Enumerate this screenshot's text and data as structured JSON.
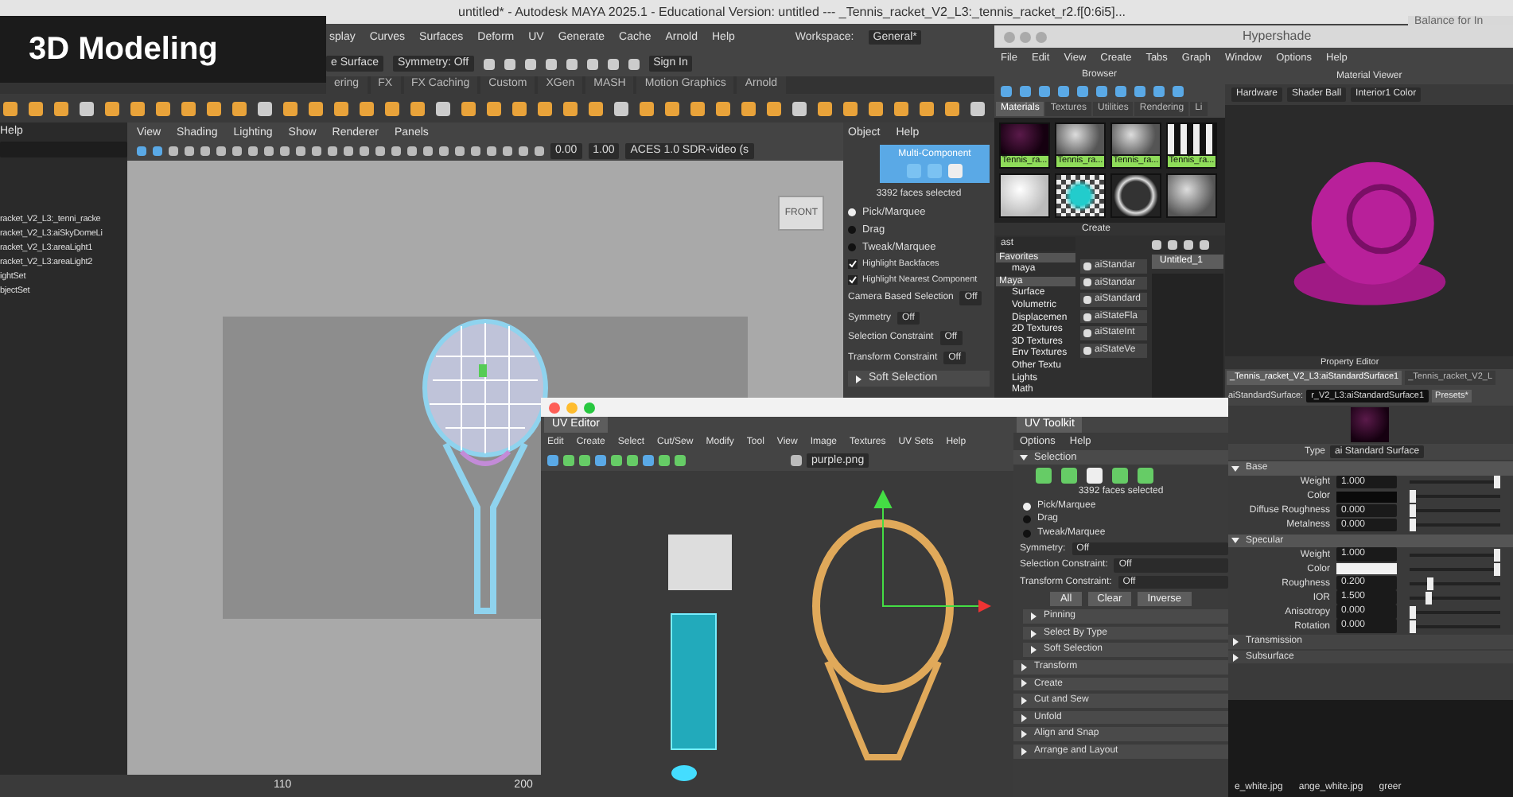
{
  "overlay_title": "3D Modeling",
  "main_window": {
    "title": "untitled* - Autodesk MAYA 2025.1 - Educational Version: untitled  ---  _Tennis_racket_V2_L3:_tennis_racket_r2.f[0:6i5]...",
    "menu": [
      "splay",
      "Curves",
      "Surfaces",
      "Deform",
      "UV",
      "Generate",
      "Cache",
      "Arnold",
      "Help"
    ],
    "workspace_label": "Workspace:",
    "workspace": "General*",
    "status_fields": [
      "e Surface",
      "Symmetry: Off"
    ],
    "sign_in": "Sign In",
    "shelf_tabs": [
      "ering",
      "FX",
      "FX Caching",
      "Custom",
      "XGen",
      "MASH",
      "Motion Graphics",
      "Arnold"
    ],
    "outliner": {
      "menu": "Help",
      "items": [
        "racket_V2_L3:_tenni_racke",
        "racket_V2_L3:aiSkyDomeLi",
        "racket_V2_L3:areaLight1",
        "racket_V2_L3:areaLight2",
        "ightSet",
        "bjectSet"
      ]
    },
    "viewport": {
      "menu": [
        "View",
        "Shading",
        "Lighting",
        "Show",
        "Renderer",
        "Panels"
      ],
      "exposure": "0.00",
      "gamma": "1.00",
      "color_space": "ACES 1.0 SDR-video (s",
      "view_cube": "FRONT"
    },
    "toolkit": {
      "menu": [
        "Object",
        "Help"
      ],
      "mode": "Multi-Component",
      "count": "3392 faces selected",
      "radios": [
        {
          "label": "Pick/Marquee",
          "selected": true
        },
        {
          "label": "Drag",
          "selected": false
        },
        {
          "label": "Tweak/Marquee",
          "selected": false
        }
      ],
      "checks": [
        {
          "label": "Highlight Backfaces",
          "checked": true
        },
        {
          "label": "Highlight Nearest Component",
          "checked": true
        }
      ],
      "options": [
        {
          "label": "Camera Based Selection",
          "value": "Off"
        },
        {
          "label": "Symmetry",
          "value": "Off"
        },
        {
          "label": "Selection Constraint",
          "value": "Off"
        },
        {
          "label": "Transform Constraint",
          "value": "Off"
        }
      ],
      "section": "Soft Selection"
    },
    "timeline": [
      "110",
      "200"
    ]
  },
  "other_window_title": "Balance for In",
  "hypershade": {
    "title": "Hypershade",
    "menu": [
      "File",
      "Edit",
      "View",
      "Create",
      "Tabs",
      "Graph",
      "Window",
      "Options",
      "Help"
    ],
    "browser": {
      "title": "Browser",
      "tabs": [
        {
          "label": "Materials",
          "selected": true
        },
        {
          "label": "Textures",
          "selected": false
        },
        {
          "label": "Utilities",
          "selected": false
        },
        {
          "label": "Rendering",
          "selected": false
        },
        {
          "label": "Li",
          "selected": false
        }
      ],
      "swatches": [
        {
          "kind": "dark",
          "label": "Tennis_ra..."
        },
        {
          "kind": "gray",
          "label": "Tennis_ra..."
        },
        {
          "kind": "gray",
          "label": "Tennis_ra..."
        },
        {
          "kind": "stripes",
          "label": "Tennis_ra..."
        },
        {
          "kind": "white"
        },
        {
          "kind": "checker"
        },
        {
          "kind": "chrome"
        },
        {
          "kind": "gray"
        }
      ]
    },
    "create": {
      "title": "Create",
      "search": "ast",
      "tree": [
        {
          "label": "Favorites",
          "children": [
            {
              "label": "maya"
            }
          ]
        },
        {
          "label": "Maya",
          "children": [
            {
              "label": "Surface"
            },
            {
              "label": "Volumetric"
            },
            {
              "label": "Displacemen"
            },
            {
              "label": "2D Textures"
            },
            {
              "label": "3D Textures"
            },
            {
              "label": "Env Textures"
            },
            {
              "label": "Other Textu"
            },
            {
              "label": "Lights"
            },
            {
              "label": "Math"
            }
          ]
        }
      ],
      "nodes": [
        "aiStandar",
        "aiStandar",
        "aiStandard",
        "aiStateFla",
        "aiStateInt",
        "aiStateVe"
      ]
    },
    "graph_tab": "Untitled_1",
    "viewer": {
      "title": "Material Viewer",
      "renderer": "Hardware",
      "geometry": "Shader Ball",
      "environment": "Interior1 Color"
    },
    "property_editor": {
      "title": "Property Editor",
      "tabs": [
        {
          "label": "_Tennis_racket_V2_L3:aiStandardSurface1",
          "selected": true
        },
        {
          "label": "_Tennis_racket_V2_L",
          "selected": false
        }
      ],
      "node_label": "aiStandardSurface:",
      "node_name": "r_V2_L3:aiStandardSurface1",
      "presets": "Presets*",
      "type_label": "Type",
      "type": "ai Standard Surface",
      "sections": [
        {
          "title": "Base",
          "expanded": true,
          "rows": [
            {
              "kind": "number",
              "label": "Weight",
              "value": "1.000",
              "level": 1
            },
            {
              "kind": "color",
              "label": "Color",
              "color": "#0a0a0a",
              "level": 0
            },
            {
              "kind": "number",
              "label": "Diffuse Roughness",
              "value": "0.000",
              "level": 0
            },
            {
              "kind": "number",
              "label": "Metalness",
              "value": "0.000",
              "level": 0
            }
          ]
        },
        {
          "title": "Specular",
          "expanded": true,
          "rows": [
            {
              "kind": "number",
              "label": "Weight",
              "value": "1.000",
              "level": 1
            },
            {
              "kind": "color",
              "label": "Color",
              "color": "#f2f2f2",
              "level": 1
            },
            {
              "kind": "number",
              "label": "Roughness",
              "value": "0.200",
              "level": 0.2
            },
            {
              "kind": "number",
              "label": "IOR",
              "value": "1.500",
              "level": 0.18
            },
            {
              "kind": "number",
              "label": "Anisotropy",
              "value": "0.000",
              "level": 0
            },
            {
              "kind": "number",
              "label": "Rotation",
              "value": "0.000",
              "level": 0
            }
          ]
        },
        {
          "title": "Transmission",
          "expanded": false
        },
        {
          "title": "Subsurface",
          "expanded": false
        }
      ]
    }
  },
  "uv_editor": {
    "tab": "UV Editor",
    "menu": [
      "Edit",
      "Create",
      "Select",
      "Cut/Sew",
      "Modify",
      "Tool",
      "View",
      "Image",
      "Textures",
      "UV Sets",
      "Help"
    ],
    "texture": "purple.png",
    "toolkit": {
      "tab": "UV Toolkit",
      "menu": [
        "Options",
        "Help"
      ],
      "section": "Selection",
      "count": "3392 faces selected",
      "radios": [
        {
          "label": "Pick/Marquee",
          "selected": true
        },
        {
          "label": "Drag",
          "selected": false
        },
        {
          "label": "Tweak/Marquee",
          "selected": false
        }
      ],
      "options": [
        {
          "label": "Symmetry:",
          "value": "Off"
        },
        {
          "label": "Selection Constraint:",
          "value": "Off"
        },
        {
          "label": "Transform Constraint:",
          "value": "Off"
        }
      ],
      "buttons": [
        "All",
        "Clear",
        "Inverse"
      ],
      "subsections": [
        "Pinning",
        "Select By Type",
        "Soft Selection"
      ],
      "sections": [
        "Transform",
        "Create",
        "Cut and Sew",
        "Unfold",
        "Align and Snap",
        "Arrange and Layout"
      ]
    }
  },
  "files": [
    "e_white.jpg",
    "ange_white.jpg",
    "greer"
  ]
}
